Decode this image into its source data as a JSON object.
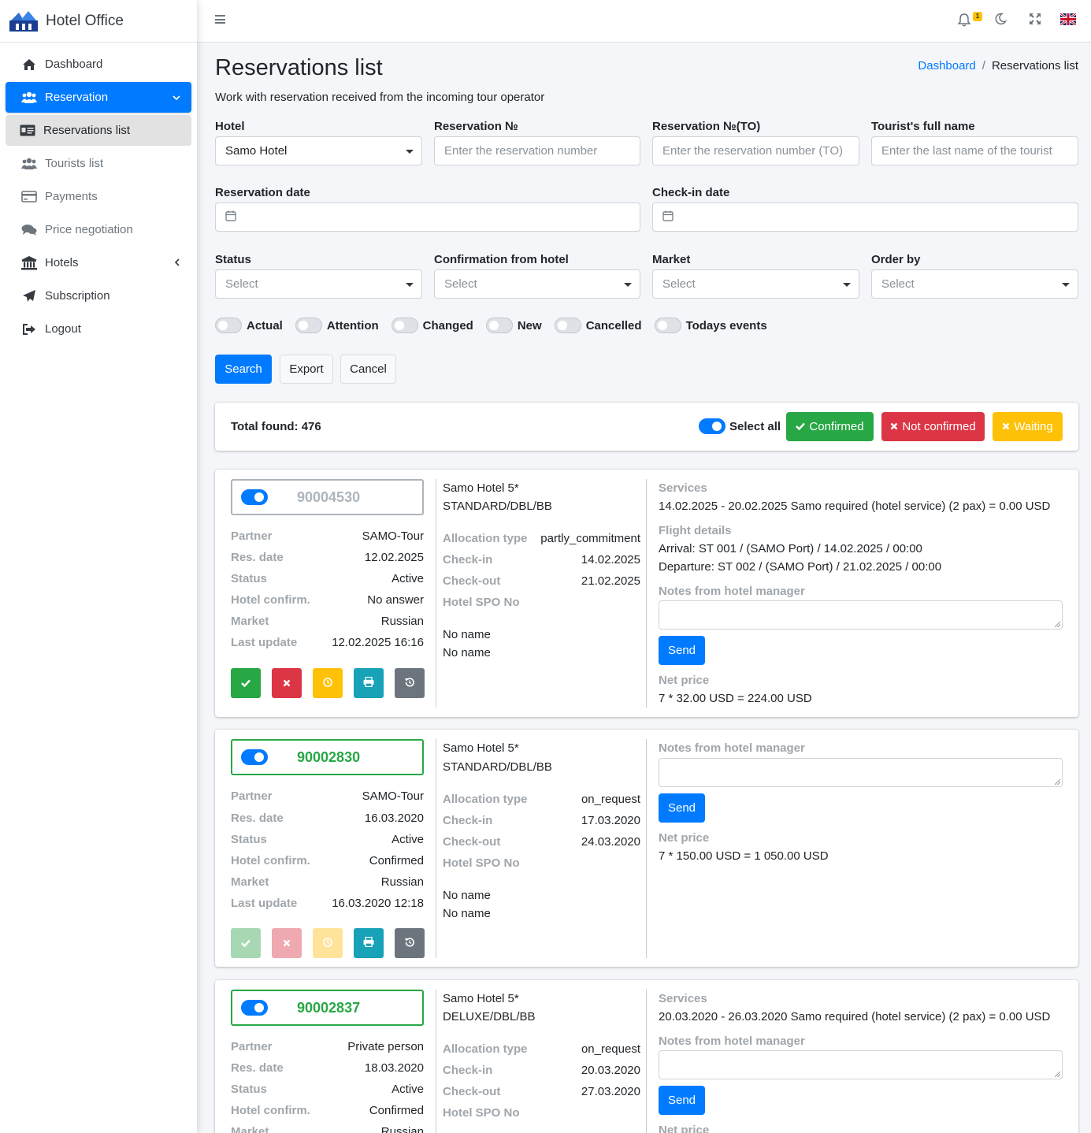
{
  "app": {
    "title": "Hotel Office"
  },
  "sidebar": {
    "items": [
      {
        "label": "Dashboard",
        "icon": "home-icon"
      },
      {
        "label": "Reservation",
        "icon": "users-icon"
      },
      {
        "label": "Reservations list",
        "icon": "id-card-icon"
      },
      {
        "label": "Tourists list",
        "icon": "users-icon"
      },
      {
        "label": "Payments",
        "icon": "credit-card-icon"
      },
      {
        "label": "Price negotiation",
        "icon": "comments-icon"
      },
      {
        "label": "Hotels",
        "icon": "bank-icon"
      },
      {
        "label": "Subscription",
        "icon": "paper-plane-icon"
      },
      {
        "label": "Logout",
        "icon": "sign-out-icon"
      }
    ]
  },
  "topbar": {
    "notification_count": "1",
    "colors": {
      "badge": "#ffc107"
    }
  },
  "page": {
    "title": "Reservations list",
    "subtitle": "Work with reservation received from the incoming tour operator",
    "breadcrumb": {
      "home": "Dashboard",
      "current": "Reservations list"
    }
  },
  "filters": {
    "hotel": {
      "label": "Hotel",
      "value": "Samo Hotel"
    },
    "res_no": {
      "label": "Reservation №",
      "placeholder": "Enter the reservation number"
    },
    "res_no_to": {
      "label": "Reservation №(TO)",
      "placeholder": "Enter the reservation number (TO)"
    },
    "tourist": {
      "label": "Tourist's full name",
      "placeholder": "Enter the last name of the tourist"
    },
    "res_date": {
      "label": "Reservation date"
    },
    "checkin_date": {
      "label": "Check-in date"
    },
    "status": {
      "label": "Status",
      "value": "Select"
    },
    "confirmation": {
      "label": "Confirmation from hotel",
      "value": "Select"
    },
    "market": {
      "label": "Market",
      "value": "Select"
    },
    "order_by": {
      "label": "Order by",
      "value": "Select"
    },
    "toggles": [
      "Actual",
      "Attention",
      "Changed",
      "New",
      "Cancelled",
      "Todays events"
    ]
  },
  "actions": {
    "search": "Search",
    "export": "Export",
    "cancel": "Cancel"
  },
  "summary": {
    "total": "Total found: 476",
    "select_all": "Select all",
    "confirmed": "Confirmed",
    "not_confirmed": "Not confirmed",
    "waiting": "Waiting"
  },
  "labels": {
    "partner": "Partner",
    "res_date": "Res. date",
    "status": "Status",
    "hotel_confirm": "Hotel confirm.",
    "market": "Market",
    "last_update": "Last update",
    "allocation_type": "Allocation type",
    "check_in": "Check-in",
    "check_out": "Check-out",
    "hotel_spo": "Hotel SPO No",
    "services": "Services",
    "flight_details": "Flight details",
    "notes": "Notes from hotel manager",
    "send": "Send",
    "net_price": "Net price"
  },
  "reservations": [
    {
      "number": "90004530",
      "partner": "SAMO-Tour",
      "res_date": "12.02.2025",
      "status": "Active",
      "hotel_confirm": "No answer",
      "market": "Russian",
      "last_update": "12.02.2025 16:16",
      "hotel": "Samo Hotel 5*",
      "room": "STANDARD/DBL/BB",
      "allocation_type": "partly_commitment",
      "check_in": "14.02.2025",
      "check_out": "21.02.2025",
      "name1": "No name",
      "name2": "No name",
      "services": "14.02.2025 - 20.02.2025 Samo required (hotel service) (2 pax) = 0.00 USD",
      "arrival": "Arrival: ST 001 / (SAMO Port) / 14.02.2025 / 00:00",
      "departure": "Departure: ST 002 / (SAMO Port) / 21.02.2025 / 00:00",
      "net_price": "7 * 32.00 USD = 224.00 USD"
    },
    {
      "number": "90002830",
      "partner": "SAMO-Tour",
      "res_date": "16.03.2020",
      "status": "Active",
      "hotel_confirm": "Confirmed",
      "market": "Russian",
      "last_update": "16.03.2020 12:18",
      "hotel": "Samo Hotel 5*",
      "room": "STANDARD/DBL/BB",
      "allocation_type": "on_request",
      "check_in": "17.03.2020",
      "check_out": "24.03.2020",
      "name1": "No name",
      "name2": "No name",
      "net_price": "7 * 150.00 USD = 1 050.00 USD"
    },
    {
      "number": "90002837",
      "partner": "Private person",
      "res_date": "18.03.2020",
      "status": "Active",
      "hotel_confirm": "Confirmed",
      "market": "Russian",
      "hotel": "Samo Hotel 5*",
      "room": "DELUXE/DBL/BB",
      "allocation_type": "on_request",
      "check_in": "20.03.2020",
      "check_out": "27.03.2020",
      "services": "20.03.2020 - 26.03.2020 Samo required (hotel service) (2 pax) = 0.00 USD"
    }
  ]
}
